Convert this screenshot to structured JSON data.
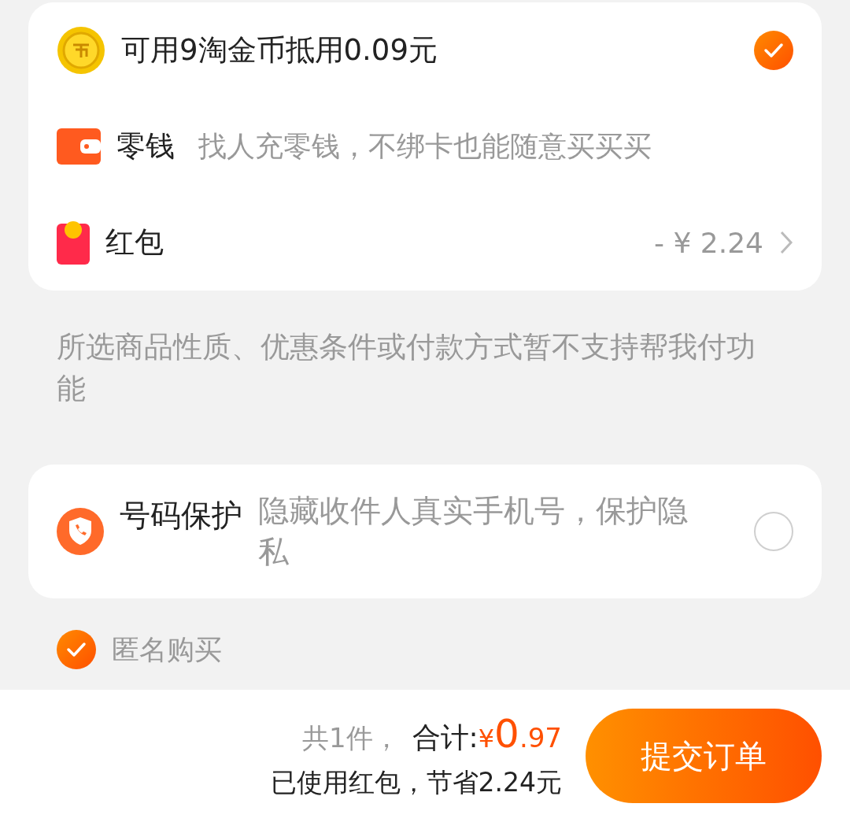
{
  "payment_card": {
    "rows": [
      {
        "kind": "coin",
        "label": "可用9淘金币抵用0.09元",
        "checked": true
      },
      {
        "kind": "wallet",
        "label": "零钱",
        "hint": "找人充零钱，不绑卡也能随意买买买"
      },
      {
        "kind": "redpacket",
        "label": "红包",
        "value": "- ¥ 2.24"
      }
    ]
  },
  "notice": "所选商品性质、优惠条件或付款方式暂不支持帮我付功能",
  "protection": {
    "label": "号码保护",
    "hint": "隐藏收件人真实手机号，保护隐私",
    "checked": false
  },
  "anonymous": {
    "label": "匿名购买",
    "checked": true
  },
  "footer": {
    "count": "共1件，",
    "total_label": "合计:",
    "currency": "¥",
    "amount_int": "0",
    "amount_dec": ".97",
    "savings": "已使用红包，节省2.24元",
    "submit": "提交订单"
  }
}
